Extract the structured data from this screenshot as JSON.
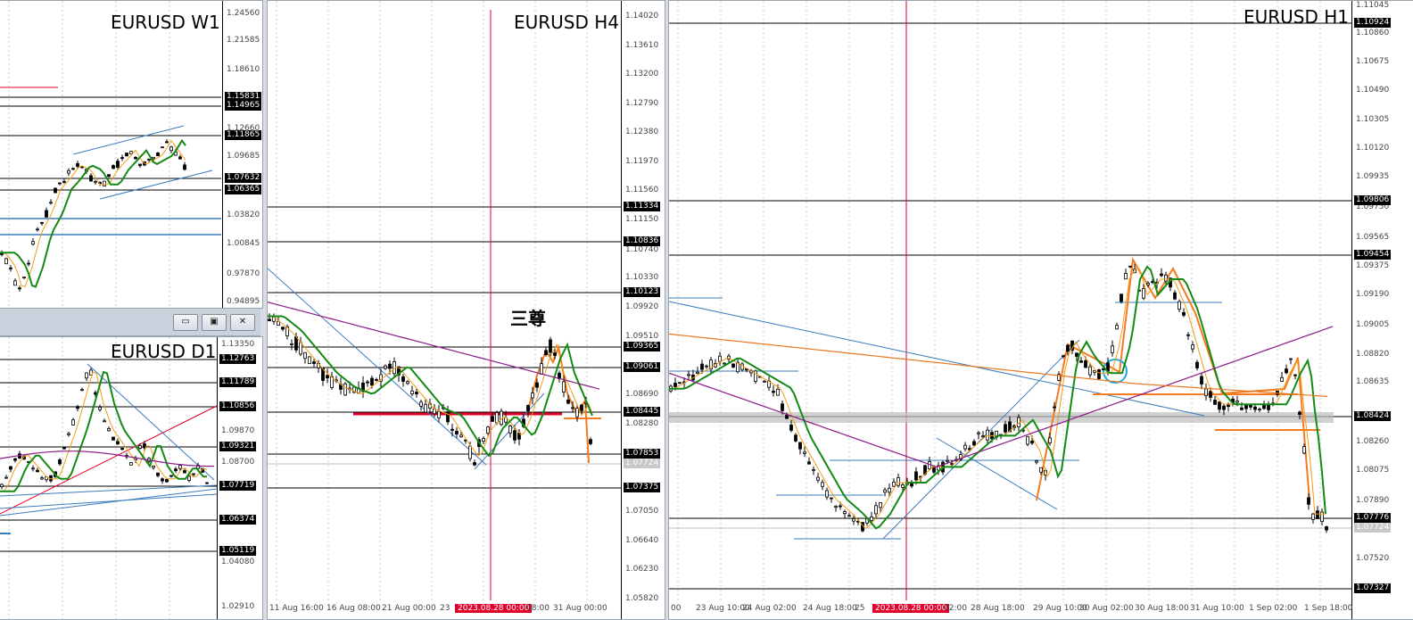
{
  "window_controls": {
    "minimize_label": "▭",
    "restore_label": "▣",
    "close_label": "✕"
  },
  "panels": [
    {
      "id": "w1",
      "title": "EURUSD W1",
      "ticks": [
        "1.24560",
        "1.21585",
        "1.18610",
        "1.12660",
        "1.09685",
        "1.03820",
        "1.00845",
        "0.97870",
        "0.94895"
      ],
      "tags": [
        "1.15831",
        "1.14965",
        "1.11865",
        "1.07632",
        "1.06365"
      ],
      "grey_tags": [],
      "xlabels": [],
      "annotation": ""
    },
    {
      "id": "d1",
      "title": "EURUSD D1",
      "ticks": [
        "1.13350",
        "1.10390",
        "1.09870",
        "1.08700",
        "1.04080",
        "1.02910"
      ],
      "tags": [
        "1.12763",
        "1.11789",
        "1.10856",
        "1.09321",
        "1.07719",
        "1.06374",
        "1.05119"
      ],
      "grey_tags": [],
      "xlabels": [],
      "annotation": ""
    },
    {
      "id": "h4",
      "title": "EURUSD H4",
      "ticks": [
        "1.14020",
        "1.13610",
        "1.13200",
        "1.12790",
        "1.12380",
        "1.11970",
        "1.11560",
        "1.11150",
        "1.10740",
        "1.10330",
        "1.09920",
        "1.09510",
        "1.08690",
        "1.08280",
        "1.07050",
        "1.06640",
        "1.06230",
        "1.05820"
      ],
      "tags": [
        "1.11334",
        "1.10836",
        "1.10123",
        "1.09365",
        "1.09061",
        "1.08445",
        "1.07853",
        "1.07375"
      ],
      "grey_tags": [
        "1.07724"
      ],
      "xlabels": [
        "11 Aug 16:00",
        "16 Aug 08:00",
        "21 Aug 00:00",
        "23",
        "2023.08.28 00:00",
        "08:00",
        "31 Aug 00:00"
      ],
      "annotation": "三尊"
    },
    {
      "id": "h1",
      "title": "EURUSD H1",
      "ticks": [
        "1.11045",
        "1.10860",
        "1.10675",
        "1.10490",
        "1.10305",
        "1.10120",
        "1.09935",
        "1.09750",
        "1.09565",
        "1.09375",
        "1.09190",
        "1.09005",
        "1.08820",
        "1.08635",
        "1.08260",
        "1.08075",
        "1.07890",
        "1.07520"
      ],
      "tags": [
        "1.10924",
        "1.09806",
        "1.09454",
        "1.08424",
        "1.07776",
        "1.07327"
      ],
      "grey_tags": [
        "1.07724"
      ],
      "xlabels": [
        "00",
        "23 Aug 10:00",
        "24 Aug 02:00",
        "24 Aug 18:00",
        "25",
        "2023.08.28 00:00",
        "02:00",
        "28 Aug 18:00",
        "29 Aug 10:00",
        "30 Aug 02:00",
        "30 Aug 18:00",
        "31 Aug 10:00",
        "1 Sep 02:00",
        "1 Sep 18:00"
      ],
      "annotation": ""
    }
  ],
  "colors": {
    "bull": "#ffffff",
    "bear": "#000000",
    "ma_fast": "#f39c12",
    "ma_mid": "#138a13",
    "ma_slow": "#8b1a8b",
    "ma_long": "#e87722",
    "trend_line": "#3a7bbf",
    "horizontal": "#000000",
    "event_line": "#e0002a",
    "pattern": "#f47b20",
    "zone": "#bdbdbd",
    "circle": "#2aa7e0"
  }
}
